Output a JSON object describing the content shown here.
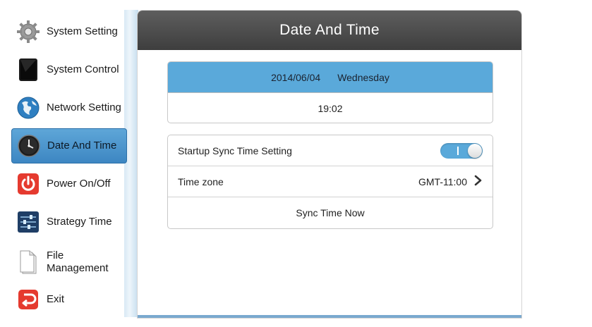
{
  "sidebar": {
    "items": [
      {
        "label": "System Setting",
        "icon": "gear-icon"
      },
      {
        "label": "System Control",
        "icon": "tablet-icon"
      },
      {
        "label": "Network Setting",
        "icon": "globe-icon"
      },
      {
        "label": "Date And Time",
        "icon": "clock-icon",
        "active": true
      },
      {
        "label": "Power On/Off",
        "icon": "power-icon"
      },
      {
        "label": "Strategy Time",
        "icon": "sliders-icon"
      },
      {
        "label": "File Management",
        "label_line1": "File",
        "label_line2": "Management",
        "icon": "document-icon"
      },
      {
        "label": "Exit",
        "icon": "exit-icon"
      }
    ]
  },
  "panel": {
    "title": "Date And Time",
    "date": "2014/06/04",
    "weekday": "Wednesday",
    "time": "19:02",
    "startup_sync_label": "Startup Sync Time Setting",
    "startup_sync_enabled": true,
    "toggle_text": "I",
    "timezone_label": "Time zone",
    "timezone_value": "GMT-11:00",
    "sync_now_label": "Sync Time Now"
  },
  "colors": {
    "accent": "#5aa9da",
    "titlebar": "#4a4a4a",
    "power_red": "#e53a2f"
  }
}
